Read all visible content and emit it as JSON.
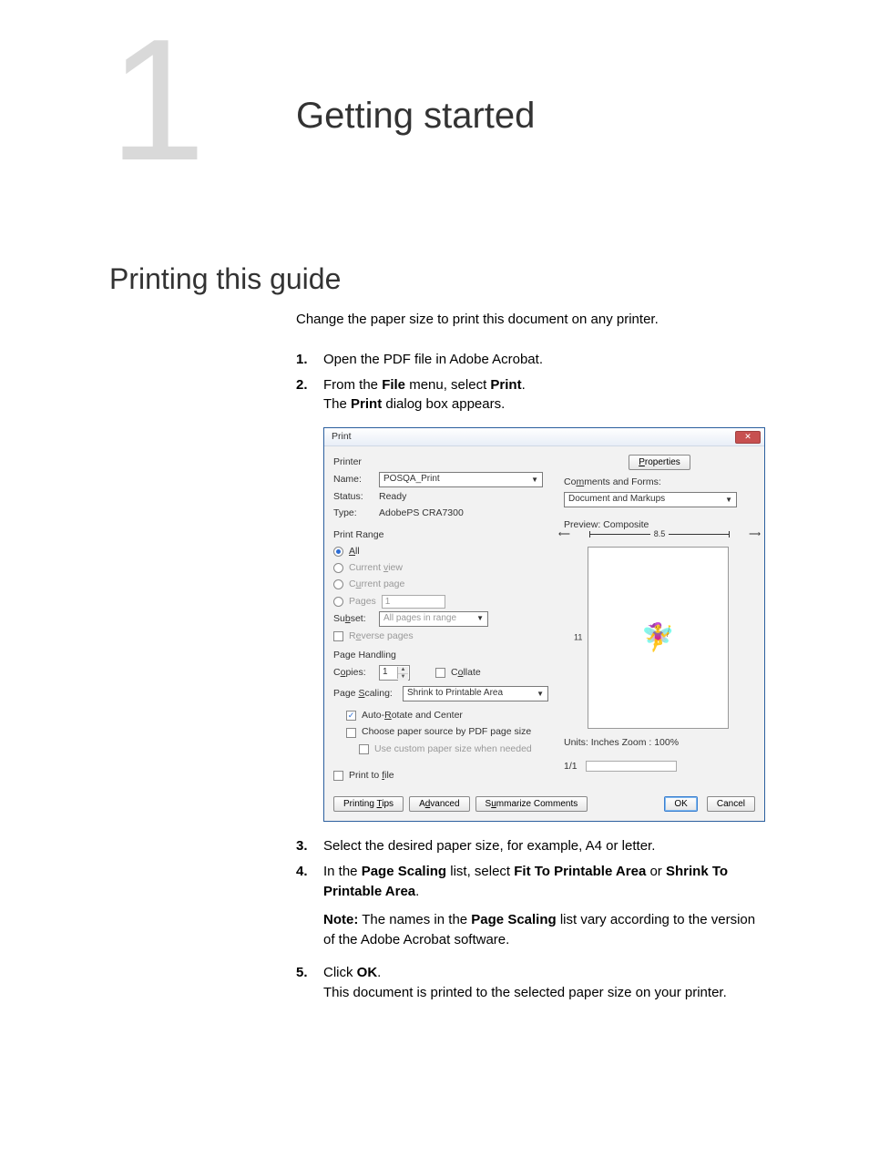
{
  "chapter": {
    "number": "1",
    "title": "Getting started"
  },
  "section": {
    "title": "Printing this guide"
  },
  "intro": "Change the paper size to print this document on any printer.",
  "steps": {
    "s1": {
      "num": "1.",
      "text": "Open the PDF file in Adobe Acrobat."
    },
    "s2": {
      "num": "2.",
      "t1": "From the ",
      "b1": "File",
      "t2": " menu, select ",
      "b2": "Print",
      "t3": ".",
      "line2a": "The ",
      "line2b": "Print",
      "line2c": " dialog box appears."
    },
    "s3": {
      "num": "3.",
      "text": "Select the desired paper size, for example, A4 or letter."
    },
    "s4": {
      "num": "4.",
      "t1": "In the ",
      "b1": "Page Scaling",
      "t2": " list, select ",
      "b2": "Fit To Printable Area",
      "t3": " or ",
      "b3": "Shrink To Printable Area",
      "t4": "."
    },
    "note": {
      "label": "Note:",
      "t1": " The names in the ",
      "b1": "Page Scaling",
      "t2": " list vary according to the version of the Adobe Acrobat software."
    },
    "s5": {
      "num": "5.",
      "t1": "Click ",
      "b1": "OK",
      "t2": ".",
      "line2": "This document is printed to the selected paper size on your printer."
    }
  },
  "dialog": {
    "title": "Print",
    "printer": {
      "label": "Printer",
      "name_lbl": "Name:",
      "name_val": "POSQA_Print",
      "status_lbl": "Status:",
      "status_val": "Ready",
      "type_lbl": "Type:",
      "type_val": "AdobePS CRA7300",
      "properties": "Properties",
      "cf_lbl": "Comments and Forms:",
      "cf_val": "Document and Markups"
    },
    "range": {
      "label": "Print Range",
      "all": "All",
      "view": "Current view",
      "page": "Current page",
      "pages": "Pages",
      "pages_val": "1",
      "subset_lbl": "Subset:",
      "subset_val": "All pages in range",
      "reverse": "Reverse pages"
    },
    "handling": {
      "label": "Page Handling",
      "copies_lbl": "Copies:",
      "copies_val": "1",
      "collate": "Collate",
      "scaling_lbl": "Page Scaling:",
      "scaling_val": "Shrink to Printable Area",
      "auto_rotate": "Auto-Rotate and Center",
      "choose_src": "Choose paper source by PDF page size",
      "custom_size": "Use custom paper size when needed"
    },
    "print_to_file": "Print to file",
    "preview": {
      "label": "Preview: Composite",
      "width": "8.5",
      "height": "11",
      "units": "Units: Inches Zoom : 100%",
      "page": "1/1"
    },
    "footer": {
      "tips": "Printing Tips",
      "advanced": "Advanced",
      "summarize": "Summarize Comments",
      "ok": "OK",
      "cancel": "Cancel"
    }
  }
}
